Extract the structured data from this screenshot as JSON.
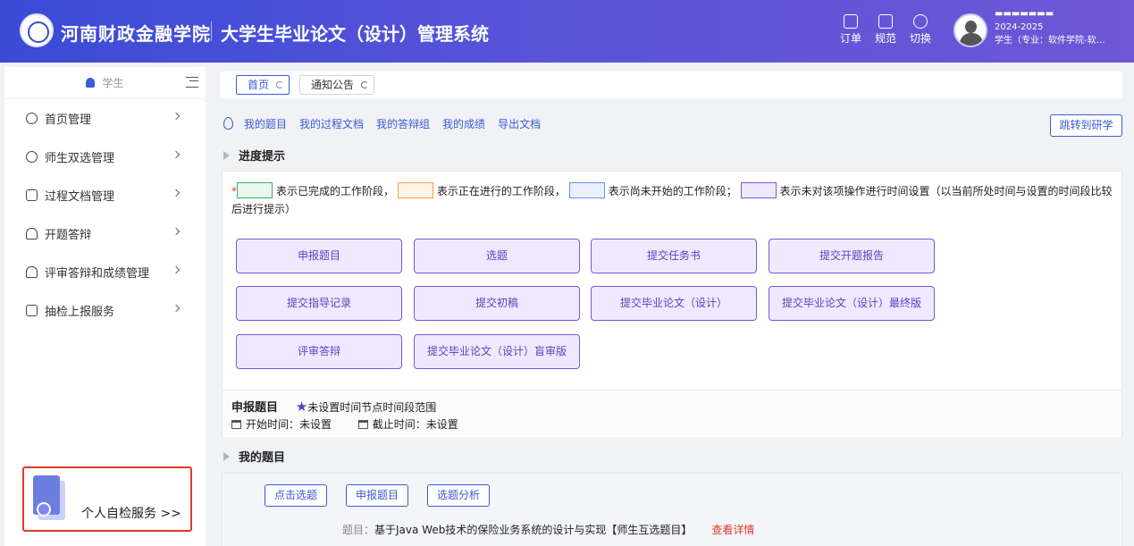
{
  "header": {
    "school_name": "河南财政金融学院",
    "system_name": "大学生毕业论文（设计）管理系统",
    "tools": [
      {
        "label": "订单",
        "icon": "order-icon"
      },
      {
        "label": "规范",
        "icon": "document-icon"
      },
      {
        "label": "切换",
        "icon": "switch-user-icon"
      }
    ],
    "user_name": "▬▬▬▬▬▬▬",
    "year": "2024-2025",
    "role_major": "学生（专业：软件学院-软…"
  },
  "sidebar": {
    "role": "学生",
    "items": [
      {
        "label": "首页管理",
        "icon": "gear-icon"
      },
      {
        "label": "师生双选管理",
        "icon": "users-icon"
      },
      {
        "label": "过程文档管理",
        "icon": "file-icon"
      },
      {
        "label": "开题答辩",
        "icon": "user-podium-icon"
      },
      {
        "label": "评审答辩和成绩管理",
        "icon": "review-icon"
      },
      {
        "label": "抽检上报服务",
        "icon": "inspect-icon"
      }
    ],
    "self_check_label": "个人自检服务 >>"
  },
  "tabs": [
    {
      "label": "首页"
    },
    {
      "label": "通知公告"
    }
  ],
  "quick_links": [
    "我的题目",
    "我的过程文档",
    "我的答辩组",
    "我的成绩",
    "导出文档"
  ],
  "jump_button": "跳转到研学",
  "progress": {
    "title": "进度提示",
    "legend_required": "*",
    "legend_completed": "表示已完成的工作阶段，",
    "legend_in_progress": "表示正在进行的工作阶段，",
    "legend_not_started": "表示尚未开始的工作阶段；",
    "legend_no_time": "表示未对该项操作进行时间设置（以当前所处时间与设置的时间段比较后进行提示）",
    "steps": [
      "申报题目",
      "选题",
      "提交任务书",
      "提交开题报告",
      "提交指导记录",
      "提交初稿",
      "提交毕业论文（设计）",
      "提交毕业论文（设计）最终版",
      "评审答辩",
      "提交毕业论文（设计）盲审版"
    ],
    "current_step": {
      "name": "申报题目",
      "star": "★",
      "note": "未设置时间节点时间段范围",
      "start_label": "开始时间：",
      "start_value": "未设置",
      "end_label": "截止时间：",
      "end_value": "未设置"
    }
  },
  "my_topic": {
    "title": "我的题目",
    "buttons": [
      "点击选题",
      "申报题目",
      "选题分析"
    ],
    "topic_label": "题目：",
    "topic_value": "基于Java Web技术的保险业务系统的设计与实现【师生互选题目】",
    "detail_link": "查看详情"
  },
  "colors": {
    "header_start": "#3a4bd6",
    "header_end": "#6e56d6",
    "accent": "#3a5bd6",
    "step_border": "#7a57d6",
    "step_fill": "#efe9ff",
    "completed": "#3cb371",
    "in_progress": "#f3a24a",
    "not_started": "#6b8ef0",
    "no_time": "#7a57d6",
    "alert": "#e0392b"
  }
}
